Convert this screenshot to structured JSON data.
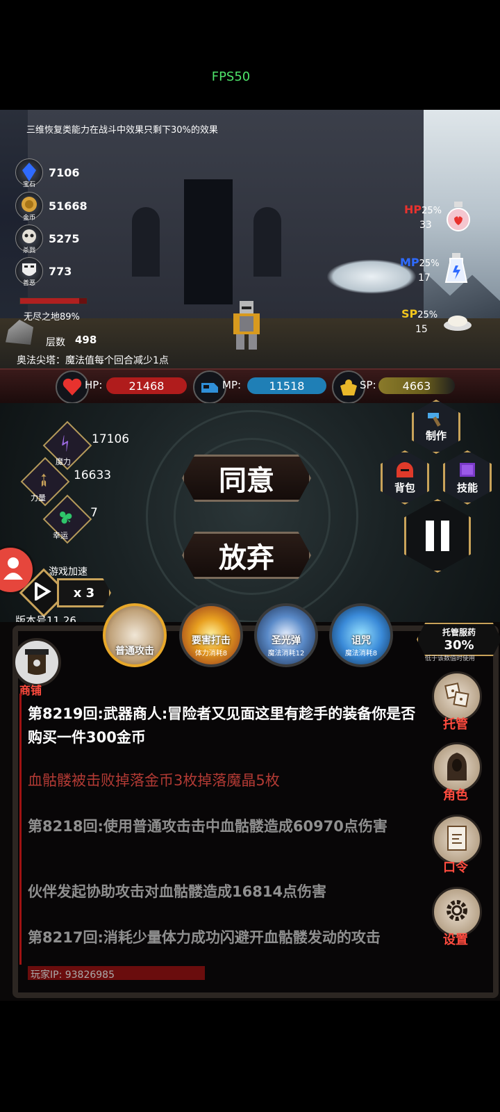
{
  "fps": "FPS50",
  "scene": {
    "tip_top": "三维恢复类能力在战斗中效果只剩下30%的效果",
    "stats": [
      {
        "value": "7106",
        "caption": "宝石",
        "icon": "gem-icon"
      },
      {
        "value": "51668",
        "caption": "金币",
        "icon": "gold-coin-icon"
      },
      {
        "value": "5275",
        "caption": "杀戮",
        "icon": "skull-icon"
      },
      {
        "value": "773",
        "caption": "善恶",
        "icon": "mask-icon"
      }
    ],
    "zone": "无尽之地89%",
    "zone_progress": 0.89,
    "layer_label": "层数",
    "layer_value": "498",
    "tip_tower": "奥法尖塔：魔法值每个回合减少1点",
    "potions": [
      {
        "type": "HP",
        "pct": "25%",
        "count": "33",
        "color": "#e8322e"
      },
      {
        "type": "MP",
        "pct": "25%",
        "count": "17",
        "color": "#2f6bff"
      },
      {
        "type": "SP",
        "pct": "25%",
        "count": "15",
        "color": "#f2c51c"
      }
    ]
  },
  "resources": {
    "hp_label": "HP:",
    "hp_value": "21468",
    "mp_label": "MP:",
    "mp_value": "11518",
    "sp_label": "SP:",
    "sp_value": "4663"
  },
  "attributes": [
    {
      "caption": "魔力",
      "value": "17106",
      "icon": "magic-icon"
    },
    {
      "caption": "力量",
      "value": "16633",
      "icon": "strength-icon"
    },
    {
      "caption": "幸运",
      "value": "7",
      "icon": "clover-icon"
    }
  ],
  "actions": {
    "agree": "同意",
    "abandon": "放弃"
  },
  "menu": {
    "craft": "制作",
    "bag": "背包",
    "skill": "技能"
  },
  "speed": {
    "label": "游戏加速",
    "multiplier": "x 3"
  },
  "version": "版本号11.26",
  "skills": [
    {
      "name": "普通攻击",
      "cost": ""
    },
    {
      "name": "要害打击",
      "cost": "体力消耗8"
    },
    {
      "name": "圣光弹",
      "cost": "魔法消耗12"
    },
    {
      "name": "诅咒",
      "cost": "魔法消耗8"
    }
  ],
  "auto_potion": {
    "title": "托管服药",
    "pct": "30%",
    "note": "低于该数值时使用"
  },
  "shop": "商铺",
  "side_buttons": [
    "托管",
    "角色",
    "口令",
    "设置"
  ],
  "logs": [
    {
      "text": "第8219回:武器商人:冒险者又见面这里有趁手的装备你是否购买一件300金币",
      "color": "#ffffff"
    },
    {
      "text": "血骷髅被击败掉落金币3枚掉落魔晶5枚",
      "color": "#b23a34"
    },
    {
      "text": "第8218回:使用普通攻击击中血骷髅造成60970点伤害",
      "color": "#8f8f8f"
    },
    {
      "text": "伙伴发起协助攻击对血骷髅造成16814点伤害",
      "color": "#8f8f8f"
    },
    {
      "text": "第8217回:消耗少量体力成功闪避开血骷髅发动的攻击",
      "color": "#8f8f8f"
    }
  ],
  "player_ip": "玩家IP: 93826985"
}
